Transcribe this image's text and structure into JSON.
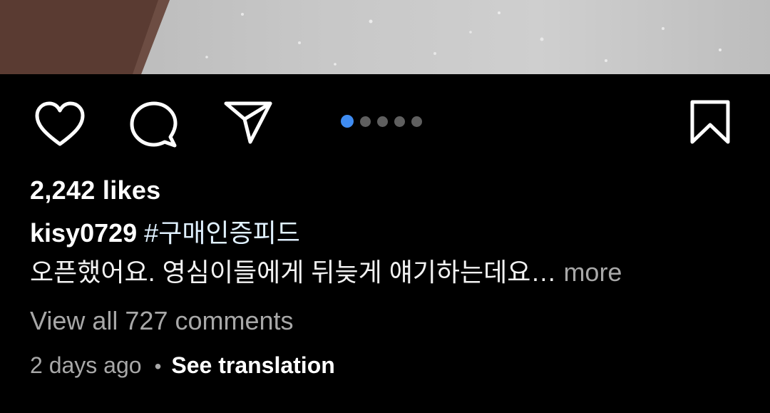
{
  "post": {
    "likes_text": "2,242 likes",
    "username": "kisy0729",
    "hashtag": "#구매인증피드",
    "caption_preview": "오픈했어요. 영심이들에게 뒤늦게 얘기하는데요…",
    "more_label": "more",
    "view_comments_label": "View all 727 comments",
    "timestamp": "2 days ago",
    "separator": "•",
    "see_translation_label": "See translation"
  },
  "carousel": {
    "total": 5,
    "active_index": 0
  },
  "icons": {
    "like": "heart-icon",
    "comment": "comment-bubble-icon",
    "share": "paper-plane-icon",
    "save": "bookmark-icon"
  },
  "colors": {
    "background": "#000000",
    "active_dot": "#3f8cf2",
    "inactive_dot": "#5f5f5f",
    "muted_text": "#a8a8a8",
    "hashtag": "#e0f1ff"
  }
}
